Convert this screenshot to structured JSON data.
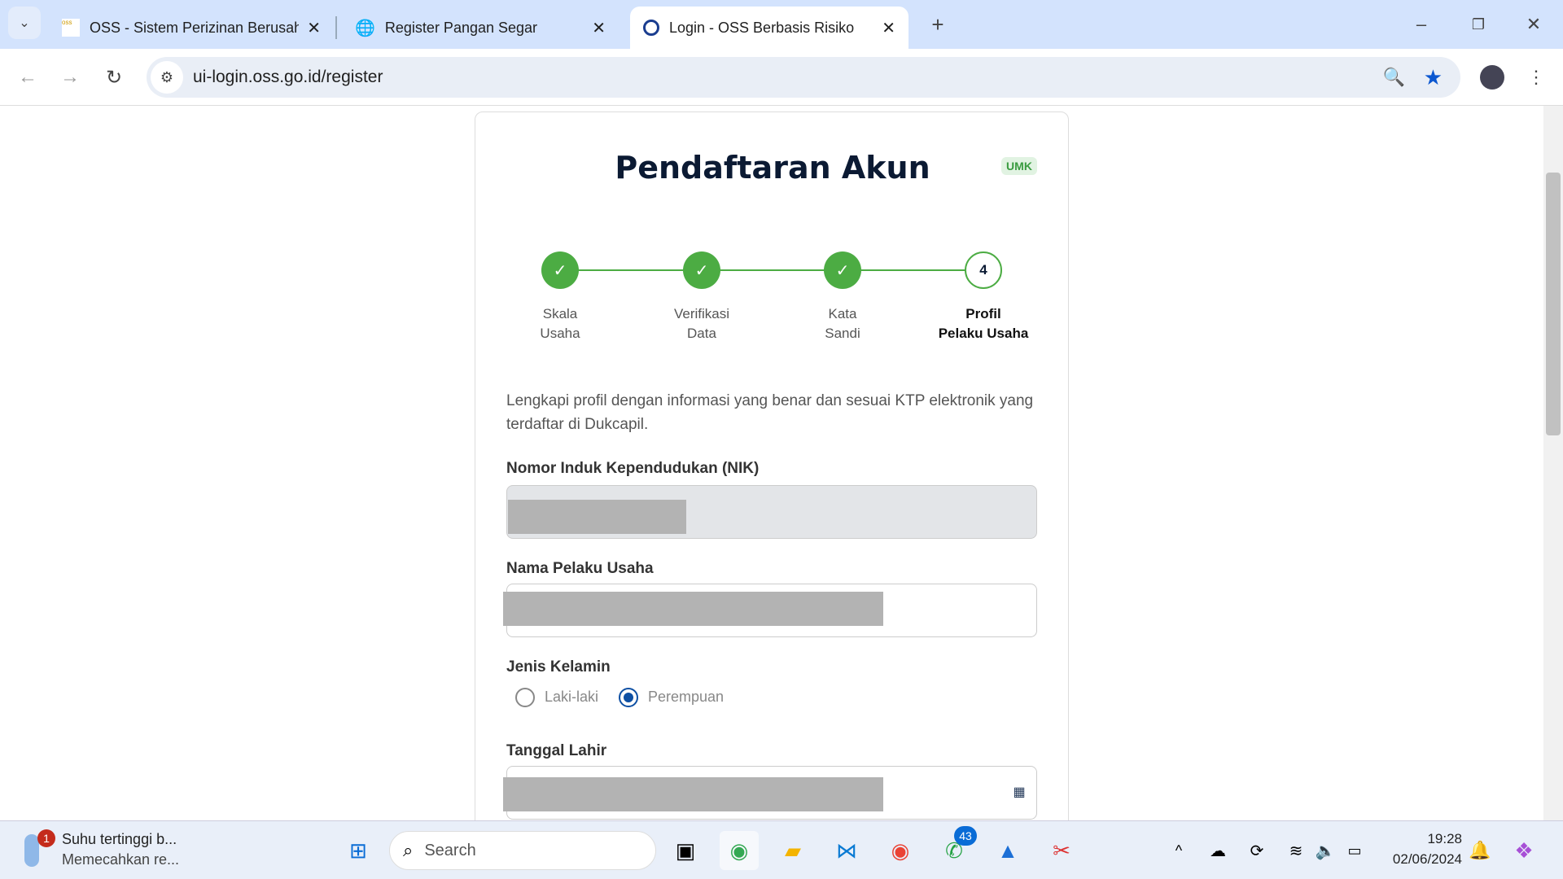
{
  "browser": {
    "tabs": [
      {
        "title": "OSS - Sistem Perizinan Berusaha",
        "active": false
      },
      {
        "title": "Register Pangan Segar",
        "active": false
      },
      {
        "title": "Login - OSS Berbasis Risiko",
        "active": true
      }
    ],
    "url": "ui-login.oss.go.id/register"
  },
  "card": {
    "title": "Pendaftaran Akun",
    "badge": "UMK",
    "steps": [
      {
        "num": "1",
        "label1": "Skala",
        "label2": "Usaha",
        "status": "done"
      },
      {
        "num": "2",
        "label1": "Verifikasi",
        "label2": "Data",
        "status": "done"
      },
      {
        "num": "3",
        "label1": "Kata",
        "label2": "Sandi",
        "status": "done"
      },
      {
        "num": "4",
        "label1": "Profil",
        "label2": "Pelaku Usaha",
        "status": "current"
      }
    ],
    "description": "Lengkapi profil dengan informasi yang benar dan sesuai KTP elektronik yang terdaftar di Dukcapil.",
    "fields": {
      "nik_label": "Nomor Induk Kependudukan (NIK)",
      "nama_label": "Nama Pelaku Usaha",
      "gender_label": "Jenis Kelamin",
      "gender_options": [
        "Laki-laki",
        "Perempuan"
      ],
      "gender_selected": "Perempuan",
      "dob_label": "Tanggal Lahir"
    }
  },
  "taskbar": {
    "weather_title": "Suhu tertinggi b...",
    "weather_sub": "Memecahkan re...",
    "weather_badge": "1",
    "search_placeholder": "Search",
    "whatsapp_badge": "43",
    "time": "19:28",
    "date": "02/06/2024"
  },
  "colors": {
    "accent_green": "#4cac43",
    "radio_blue": "#0d4fa3",
    "title": "#0b1a33"
  }
}
